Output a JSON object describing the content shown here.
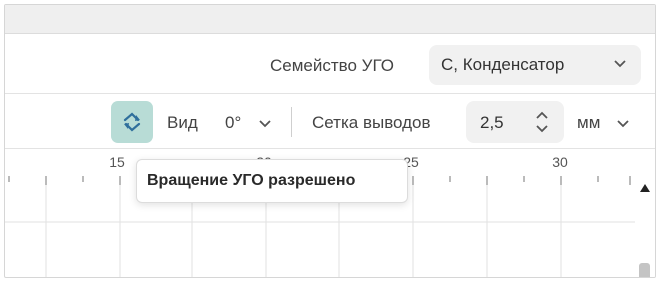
{
  "family": {
    "label": "Семейство УГО",
    "value": "С, Конденсатор",
    "icon": "chevron-down-icon"
  },
  "toolbar": {
    "rotate_icon": "rotate-arrows-icon",
    "view_label": "Вид",
    "angle_value": "0°",
    "grid_label": "Сетка выводов",
    "grid_value": "2,5",
    "unit": "мм"
  },
  "ruler": {
    "ticks": [
      "15",
      "20",
      "25",
      "30"
    ]
  },
  "tooltip": {
    "text": "Вращение УГО разрешено"
  },
  "colors": {
    "rotate_button_bg": "#b8dcd6",
    "field_bg": "#f1f1f1"
  }
}
